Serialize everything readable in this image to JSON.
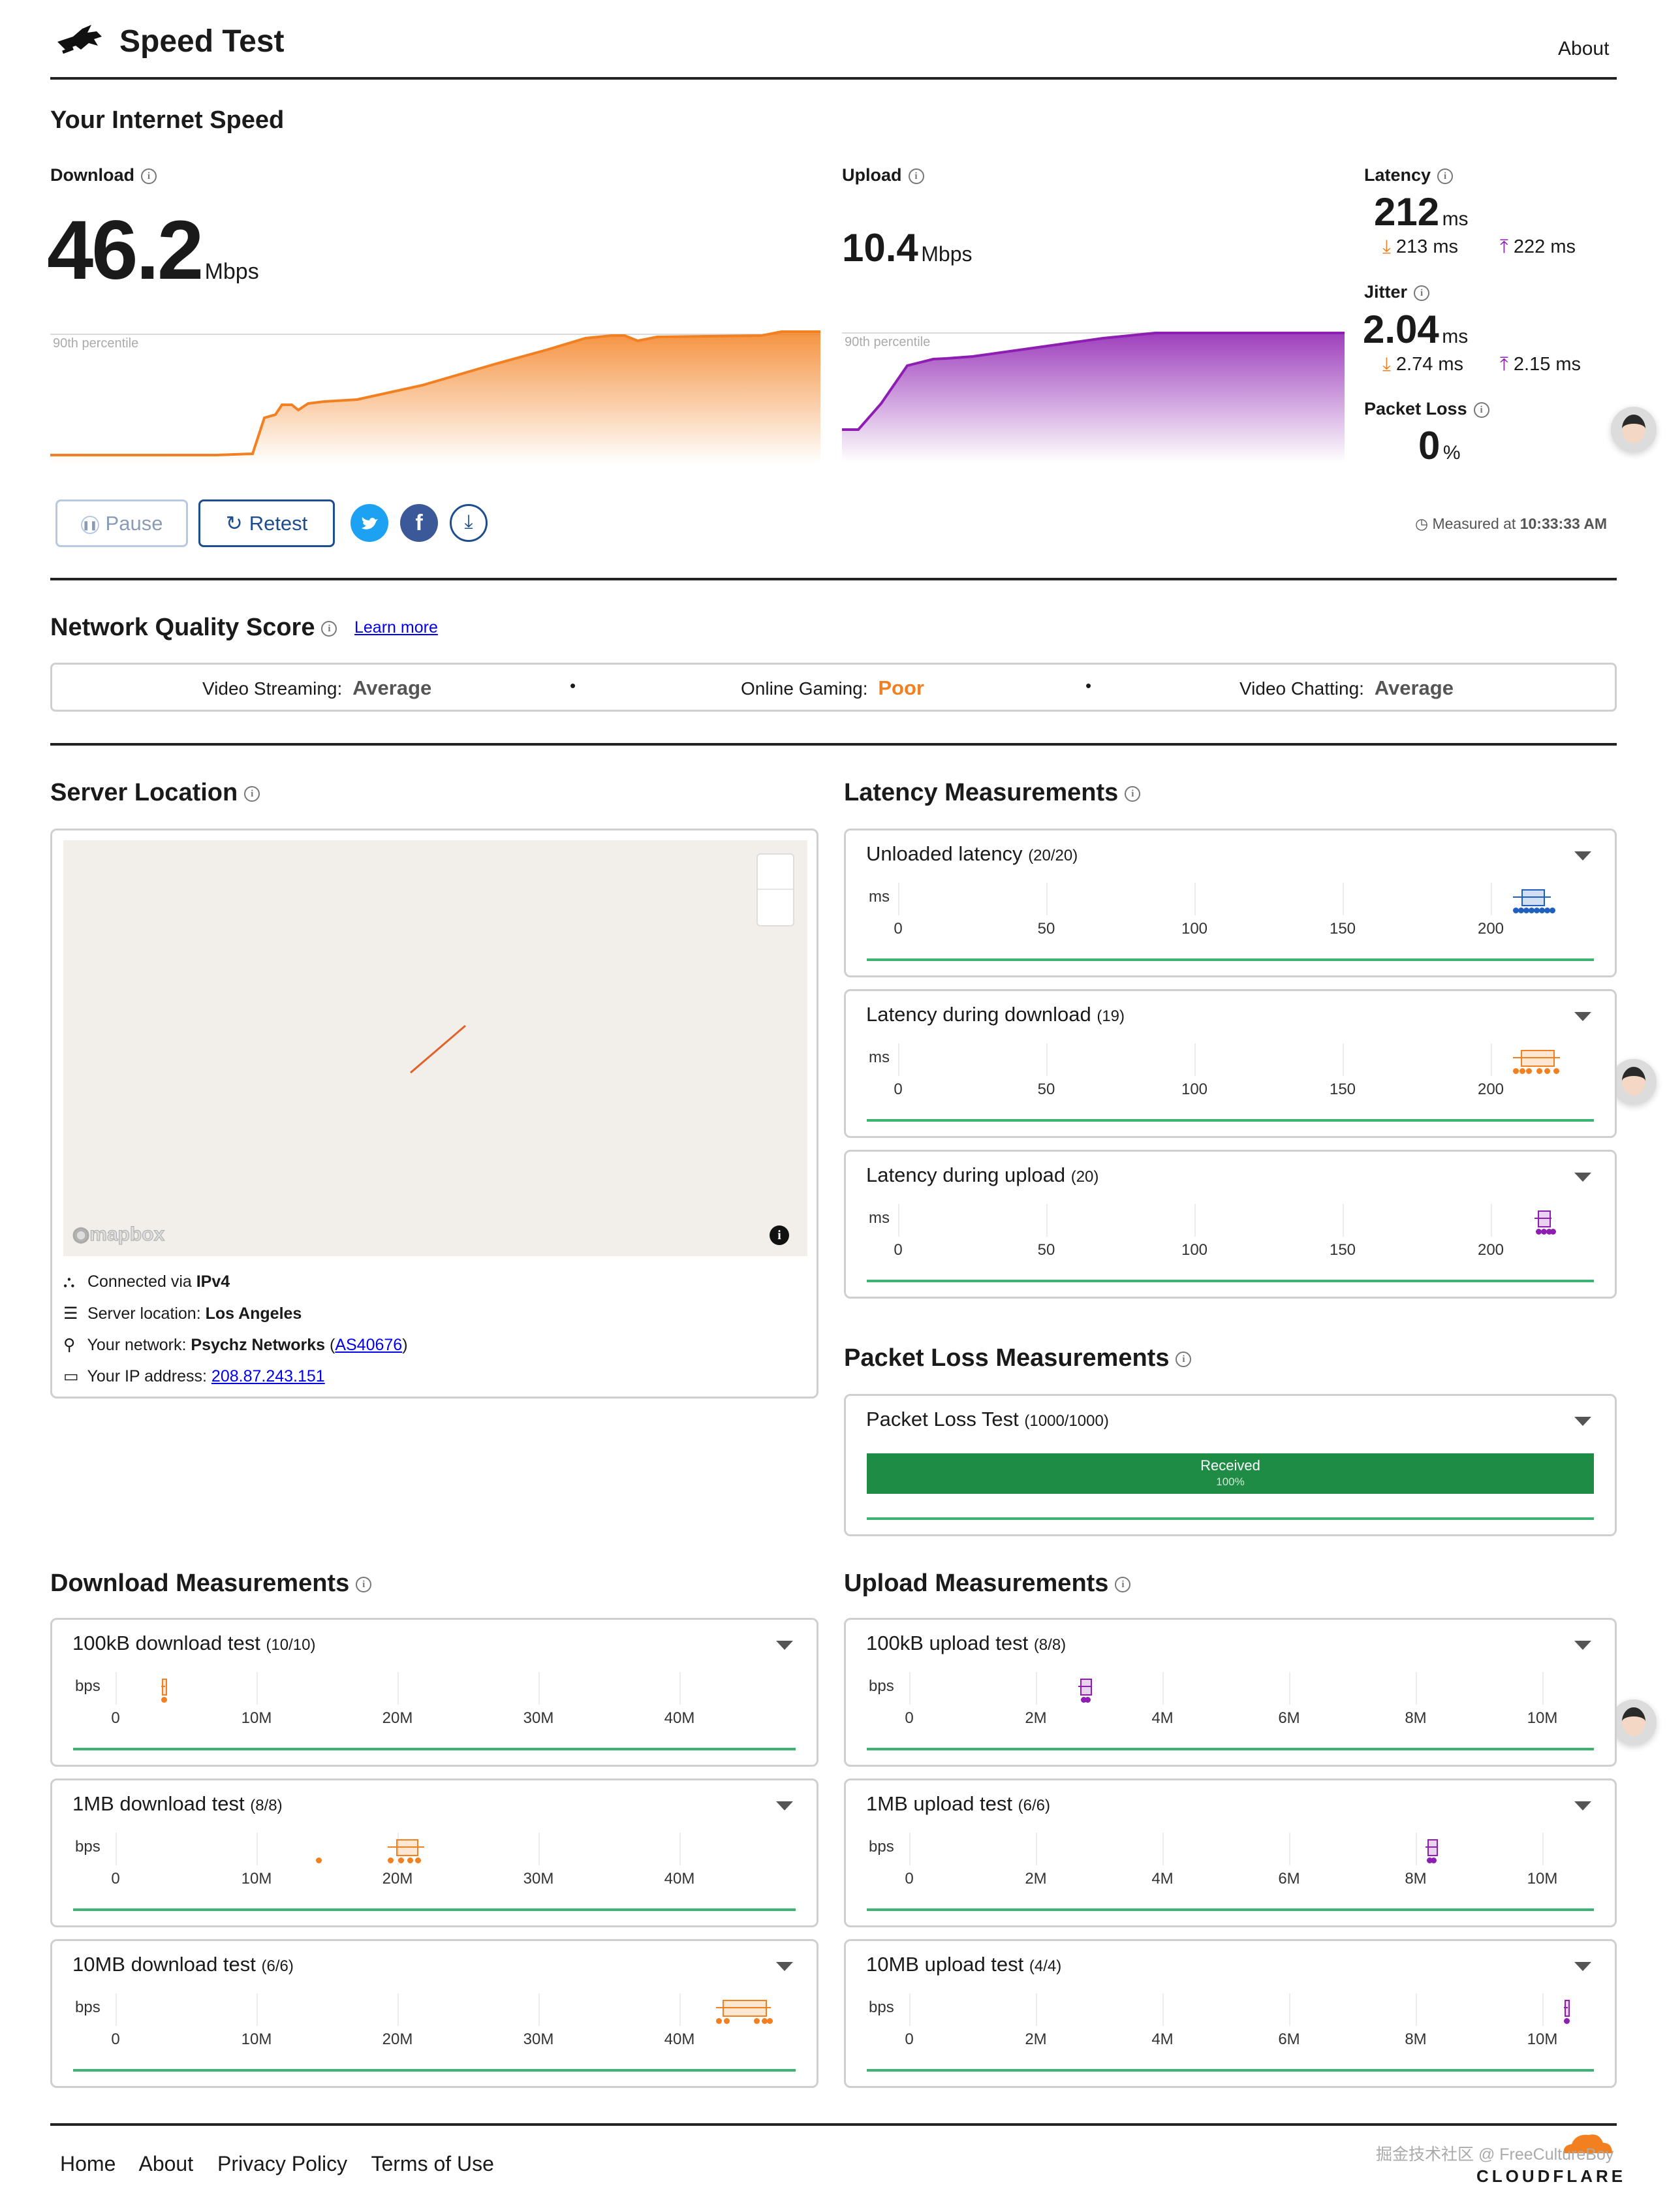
{
  "header": {
    "app_title": "Speed Test",
    "about_link": "About"
  },
  "results": {
    "section_title": "Your Internet Speed",
    "download": {
      "label": "Download",
      "value": "46.2",
      "unit": "Mbps",
      "percentile_label": "90th percentile"
    },
    "upload": {
      "label": "Upload",
      "value": "10.4",
      "unit": "Mbps",
      "percentile_label": "90th percentile"
    },
    "latency": {
      "label": "Latency",
      "value": "212",
      "unit": "ms",
      "down": "213 ms",
      "up": "222 ms"
    },
    "jitter": {
      "label": "Jitter",
      "value": "2.04",
      "unit": "ms",
      "down": "2.74 ms",
      "up": "2.15 ms"
    },
    "packet_loss": {
      "label": "Packet Loss",
      "value": "0",
      "unit": "%"
    }
  },
  "actions": {
    "pause_label": "Pause",
    "retest_label": "Retest",
    "measured_prefix": "Measured at",
    "measured_time": "10:33:33 AM"
  },
  "quality": {
    "title": "Network Quality Score",
    "learn_more": "Learn more",
    "items": [
      {
        "label": "Video Streaming:",
        "value": "Average",
        "color": "#555555"
      },
      {
        "label": "Online Gaming:",
        "value": "Poor",
        "color": "#f38020"
      },
      {
        "label": "Video Chatting:",
        "value": "Average",
        "color": "#555555"
      }
    ],
    "separator": "•"
  },
  "server": {
    "title": "Server Location",
    "map_logo": "mapbox",
    "connected_prefix": "Connected via",
    "connected_value": "IPv4",
    "location_prefix": "Server location:",
    "location_value": "Los Angeles",
    "network_prefix": "Your network:",
    "network_value": "Psychz Networks",
    "network_asn": "AS40676",
    "ip_prefix": "Your IP address:",
    "ip_value": "208.87.243.151"
  },
  "latency_measurements": {
    "title": "Latency Measurements",
    "unit": "ms",
    "ticks": [
      "0",
      "50",
      "100",
      "150",
      "200"
    ],
    "cards": [
      {
        "title": "Unloaded latency",
        "count": "(20/20)",
        "color": "#1f5fbf"
      },
      {
        "title": "Latency during download",
        "count": "(19)",
        "color": "#f38020"
      },
      {
        "title": "Latency during upload",
        "count": "(20)",
        "color": "#8d1eb1"
      }
    ]
  },
  "packet_loss_measurements": {
    "title": "Packet Loss Measurements",
    "card_title": "Packet Loss Test",
    "count": "(1000/1000)",
    "bar_label": "Received",
    "bar_percent": "100%",
    "received_fraction": 1.0,
    "bar_color": "#1e8c45"
  },
  "download_measurements": {
    "title": "Download Measurements",
    "unit": "bps",
    "ticks": [
      "0",
      "10M",
      "20M",
      "30M",
      "40M"
    ],
    "cards": [
      {
        "title": "100kB download test",
        "count": "(10/10)"
      },
      {
        "title": "1MB download test",
        "count": "(8/8)"
      },
      {
        "title": "10MB download test",
        "count": "(6/6)"
      }
    ]
  },
  "upload_measurements": {
    "title": "Upload Measurements",
    "unit": "bps",
    "ticks": [
      "0",
      "2M",
      "4M",
      "6M",
      "8M",
      "10M"
    ],
    "cards": [
      {
        "title": "100kB upload test",
        "count": "(8/8)"
      },
      {
        "title": "1MB upload test",
        "count": "(6/6)"
      },
      {
        "title": "10MB upload test",
        "count": "(4/4)"
      }
    ]
  },
  "footer": {
    "links": [
      "Home",
      "About",
      "Privacy Policy",
      "Terms of Use"
    ],
    "watermark": "掘金技术社区 @ FreeCultureBoy",
    "brand": "CLOUDFLARE"
  },
  "icons": {
    "logo": "rabbit-logo-icon",
    "info": "info-icon",
    "pause": "pause-icon",
    "retest": "refresh-icon",
    "share": [
      "twitter-icon",
      "facebook-icon",
      "download-icon"
    ],
    "clock": "clock-icon",
    "dropdown": "chevron-down-icon"
  },
  "colors": {
    "download": "#f38020",
    "upload": "#8d1eb1",
    "unloaded": "#1f5fbf",
    "link": "#0000ee",
    "success": "#3eb371"
  }
}
